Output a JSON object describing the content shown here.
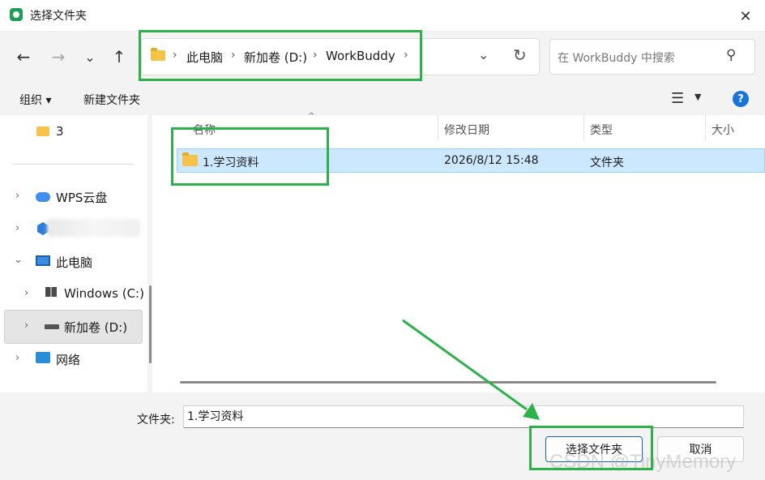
{
  "window": {
    "title": "选择文件夹",
    "close_glyph": "✕"
  },
  "nav": {
    "back_glyph": "←",
    "forward_glyph": "→",
    "recent_glyph": "⌄",
    "up_glyph": "↑",
    "breadcrumbs": [
      "此电脑",
      "新加卷 (D:)",
      "WorkBuddy"
    ],
    "separator": "›",
    "dropdown_glyph": "⌄",
    "refresh_glyph": "↻",
    "search_placeholder": "在 WorkBuddy 中搜索",
    "search_glyph": "⚲"
  },
  "toolbar": {
    "organize_label": "组织 ▾",
    "new_folder_label": "新建文件夹",
    "view_glyph": "☰",
    "view_dropdown_glyph": "▼",
    "help_glyph": "?"
  },
  "sidebar": {
    "items": [
      {
        "label": "3",
        "icon": "folder-icon"
      },
      {
        "label": "WPS云盘",
        "icon": "cloud-icon"
      },
      {
        "label": "",
        "icon": "app-icon"
      },
      {
        "label": "此电脑",
        "icon": "computer-icon"
      },
      {
        "label": "Windows (C:)",
        "icon": "windows-drive-icon"
      },
      {
        "label": "新加卷 (D:)",
        "icon": "drive-icon"
      },
      {
        "label": "网络",
        "icon": "network-icon"
      }
    ],
    "chevron_right": "›",
    "chevron_down": "⌄"
  },
  "file_list": {
    "columns": [
      "名称",
      "修改日期",
      "类型",
      "大小"
    ],
    "sort_glyph": "^",
    "rows": [
      {
        "name": "1.学习资料",
        "modified": "2026/8/12 15:48",
        "type": "文件夹",
        "size": ""
      }
    ]
  },
  "footer": {
    "folder_label": "文件夹:",
    "folder_value": "1.学习资料",
    "select_button": "选择文件夹",
    "cancel_button": "取消"
  },
  "watermark": "CSDN @TinyMemory",
  "colors": {
    "accent": "#0b64c0",
    "selection": "#cce8ff",
    "annotation_green": "#2db14a"
  }
}
